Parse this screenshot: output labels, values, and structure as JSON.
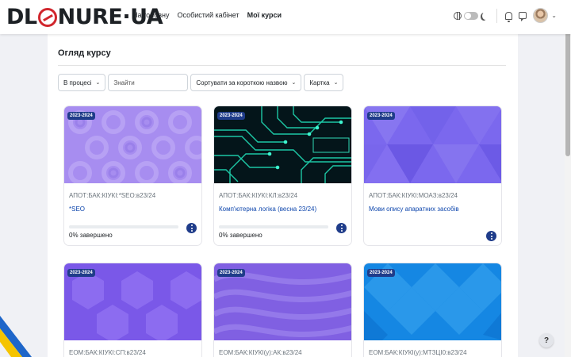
{
  "nav": {
    "logo_left": "DL",
    "logo_right": "NURE·UA",
    "links": [
      "На головну",
      "Особистий кабінет",
      "Мої курси"
    ]
  },
  "overview": {
    "title": "Огляд курсу",
    "filter_status": "В процесі",
    "search_placeholder": "Знайти",
    "sort": "Сортувати за короткою назвою",
    "view": "Картка"
  },
  "courses": [
    {
      "year": "2023-2024",
      "code": "АПОТ:БАК:КІУКІ:*SEO:в23/24",
      "name": "*SEO",
      "progress_text": "0% завершено",
      "progress": 0
    },
    {
      "year": "2023-2024",
      "code": "АПОТ:БАК:КІУКІ:КЛ:в23/24",
      "name": "Комп'ютерна логіка (весна 23/24)",
      "progress_text": "0% завершено",
      "progress": 0
    },
    {
      "year": "2023-2024",
      "code": "АПОТ:БАК:КІУКІ:МОАЗ:в23/24",
      "name": "Мови опису апаратних засобів",
      "progress_text": "",
      "progress": null
    },
    {
      "year": "2023-2024",
      "code": "ЕОМ:БАК:КІУКІ:СП:в23/24",
      "name": "",
      "progress_text": "",
      "progress": null
    },
    {
      "year": "2023-2024",
      "code": "ЕОМ:БАК:КІУКІ(у):АК:в23/24",
      "name": "",
      "progress_text": "",
      "progress": null
    },
    {
      "year": "2023-2024",
      "code": "ЕОМ:БАК:КІУКІ(у):МТЗЦІ0:в23/24",
      "name": "",
      "progress_text": "",
      "progress": null
    }
  ],
  "help": "?",
  "colors": {
    "accent": "#0f6cbf",
    "badge": "#1f3c8a",
    "link": "#0f47ad",
    "logo_red": "#d1262d"
  }
}
